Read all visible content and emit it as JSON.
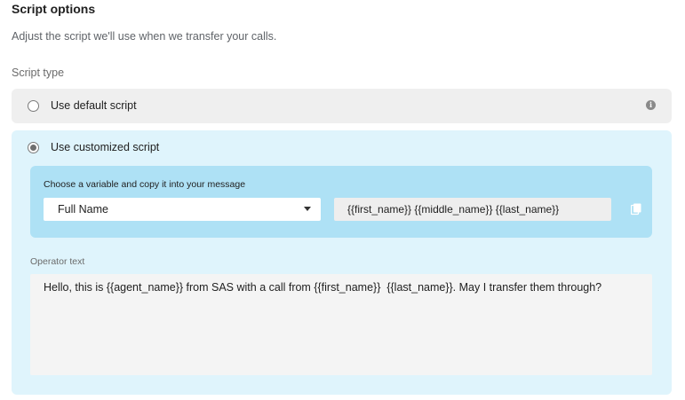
{
  "header": {
    "title": "Script options",
    "subtitle": "Adjust the script we'll use when we transfer your calls."
  },
  "script_type": {
    "label": "Script type",
    "options": [
      {
        "label": "Use default script",
        "selected": false,
        "info_icon": "info-icon"
      },
      {
        "label": "Use customized script",
        "selected": true
      }
    ]
  },
  "variables": {
    "hint": "Choose a variable and copy it into your message",
    "selected": "Full Name",
    "output": "{{first_name}} {{middle_name}} {{last_name}}",
    "copy_icon": "copy-icon"
  },
  "operator": {
    "label": "Operator text",
    "text": "Hello, this is {{agent_name}} from SAS with a call from {{first_name}}  {{last_name}}. May I transfer them through?"
  },
  "colors": {
    "default_option_bg": "#efefef",
    "custom_option_bg": "#dff4fc",
    "variable_panel_bg": "#aee1f5"
  }
}
